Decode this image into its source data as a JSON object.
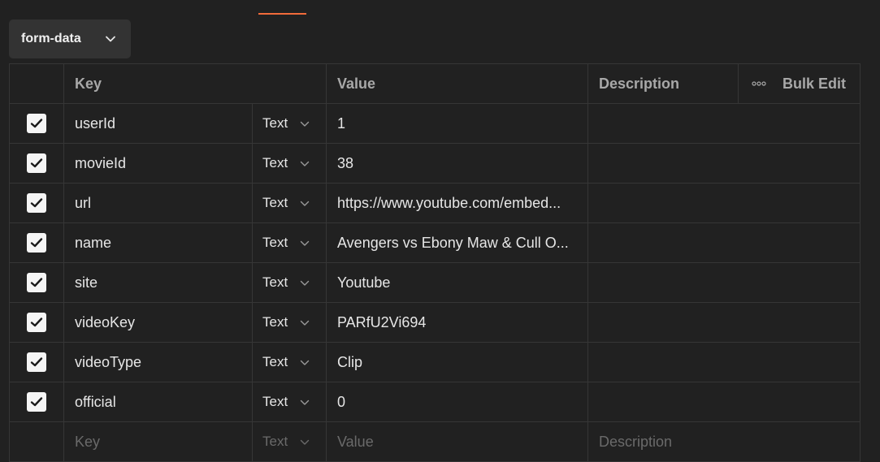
{
  "body": {
    "type_select": {
      "label": "form-data"
    }
  },
  "table": {
    "headers": {
      "key": "Key",
      "value": "Value",
      "description": "Description",
      "bulk_edit": "Bulk Edit"
    },
    "rows": [
      {
        "checked": true,
        "key": "userId",
        "type": "Text",
        "value": "1",
        "description": ""
      },
      {
        "checked": true,
        "key": "movieId",
        "type": "Text",
        "value": "38",
        "description": ""
      },
      {
        "checked": true,
        "key": "url",
        "type": "Text",
        "value": "https://www.youtube.com/embed...",
        "description": ""
      },
      {
        "checked": true,
        "key": "name",
        "type": "Text",
        "value": "Avengers vs Ebony Maw & Cull O...",
        "description": ""
      },
      {
        "checked": true,
        "key": "site",
        "type": "Text",
        "value": "Youtube",
        "description": ""
      },
      {
        "checked": true,
        "key": "videoKey",
        "type": "Text",
        "value": "PARfU2Vi694",
        "description": ""
      },
      {
        "checked": true,
        "key": "videoType",
        "type": "Text",
        "value": "Clip",
        "description": ""
      },
      {
        "checked": true,
        "key": "official",
        "type": "Text",
        "value": "0",
        "description": ""
      }
    ],
    "new_row": {
      "key_placeholder": "Key",
      "type": "Text",
      "value_placeholder": "Value",
      "description_placeholder": "Description"
    }
  }
}
